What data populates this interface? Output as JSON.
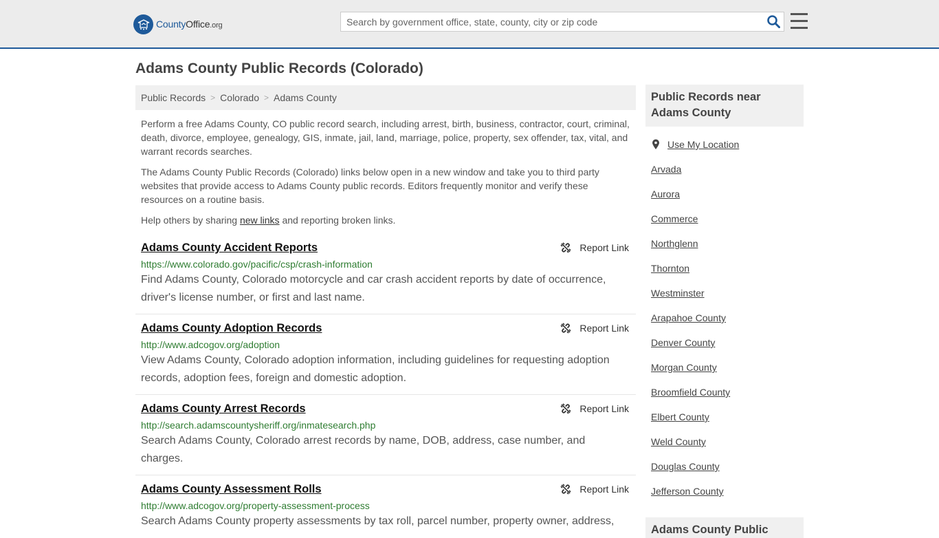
{
  "header": {
    "logo_county": "County",
    "logo_office": "Office",
    "logo_org": ".org",
    "search_placeholder": "Search by government office, state, county, city or zip code"
  },
  "page_title": "Adams County Public Records (Colorado)",
  "breadcrumb": [
    "Public Records",
    "Colorado",
    "Adams County"
  ],
  "intro": {
    "p1": "Perform a free Adams County, CO public record search, including arrest, birth, business, contractor, court, criminal, death, divorce, employee, genealogy, GIS, inmate, jail, land, marriage, police, property, sex offender, tax, vital, and warrant records searches.",
    "p2": "The Adams County Public Records (Colorado) links below open in a new window and take you to third party websites that provide access to Adams County public records. Editors frequently monitor and verify these resources on a routine basis.",
    "p3_before": "Help others by sharing ",
    "p3_link": "new links",
    "p3_after": " and reporting broken links."
  },
  "report_label": "Report Link",
  "records": [
    {
      "title": "Adams County Accident Reports",
      "url": "https://www.colorado.gov/pacific/csp/crash-information",
      "desc": "Find Adams County, Colorado motorcycle and car crash accident reports by date of occurrence, driver's license number, or first and last name."
    },
    {
      "title": "Adams County Adoption Records",
      "url": "http://www.adcogov.org/adoption",
      "desc": "View Adams County, Colorado adoption information, including guidelines for requesting adoption records, adoption fees, foreign and domestic adoption."
    },
    {
      "title": "Adams County Arrest Records",
      "url": "http://search.adamscountysheriff.org/inmatesearch.php",
      "desc": "Search Adams County, Colorado arrest records by name, DOB, address, case number, and charges."
    },
    {
      "title": "Adams County Assessment Rolls",
      "url": "http://www.adcogov.org/property-assessment-process",
      "desc": "Search Adams County property assessments by tax roll, parcel number, property owner, address,"
    }
  ],
  "sidebar": {
    "heading": "Public Records near Adams County",
    "use_location": "Use My Location",
    "items": [
      "Arvada",
      "Aurora",
      "Commerce",
      "Northglenn",
      "Thornton",
      "Westminster",
      "Arapahoe County",
      "Denver County",
      "Morgan County",
      "Broomfield County",
      "Elbert County",
      "Weld County",
      "Douglas County",
      "Jefferson County"
    ],
    "heading2": "Adams County Public"
  }
}
